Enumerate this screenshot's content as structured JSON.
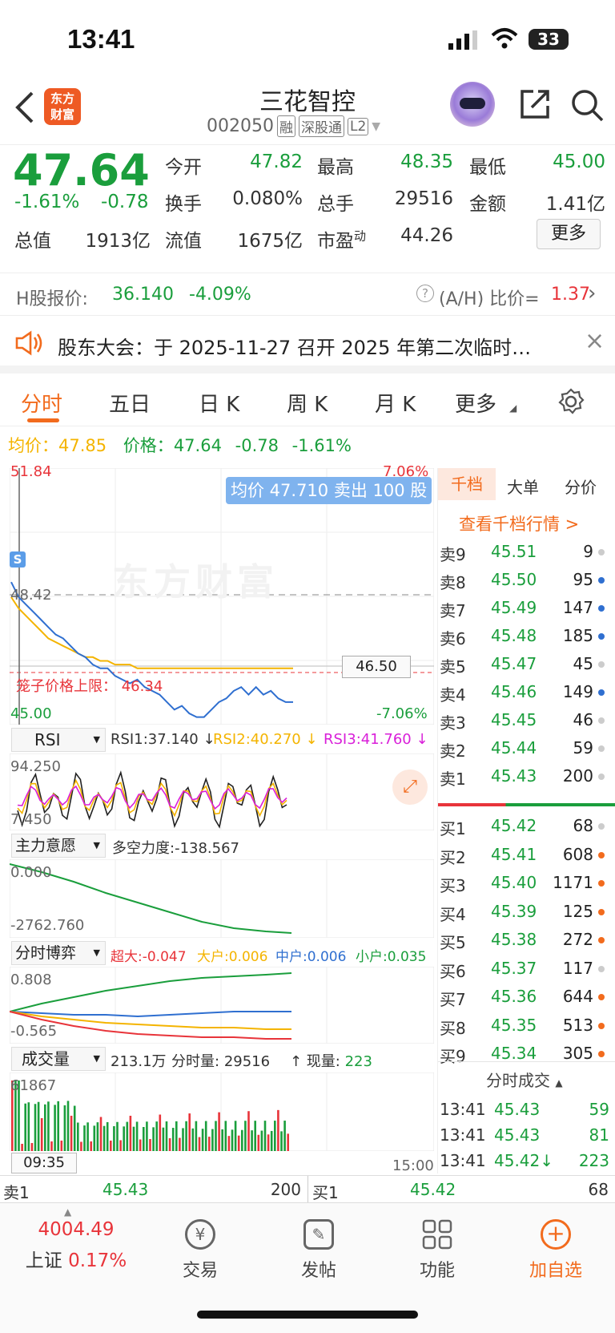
{
  "status": {
    "time": "13:41",
    "battery": "33"
  },
  "header": {
    "title": "三花智控",
    "code": "002050",
    "badges": [
      "融",
      "深股通",
      "L2"
    ],
    "logo_top": "东方",
    "logo_bottom": "财富"
  },
  "quote": {
    "price": "47.64",
    "pct": "-1.61%",
    "chg": "-0.78",
    "fields": [
      {
        "label": "今开",
        "value": "47.82",
        "color": "green"
      },
      {
        "label": "最高",
        "value": "48.35",
        "color": "green"
      },
      {
        "label": "最低",
        "value": "45.00",
        "color": "green"
      },
      {
        "label": "换手",
        "value": "0.080%",
        "color": "dark"
      },
      {
        "label": "总手",
        "value": "29516",
        "color": "dark"
      },
      {
        "label": "金额",
        "value": "1.41亿",
        "color": "dark"
      },
      {
        "label": "流值",
        "value": "1675亿",
        "color": "dark"
      },
      {
        "label": "市盈",
        "value": "44.26",
        "color": "dark"
      }
    ],
    "total_label": "总值",
    "total_value": "1913亿",
    "pe_sup": "动",
    "more": "更多"
  },
  "hshare": {
    "label": "H股报价:",
    "price": "36.140",
    "pct": "-4.09%",
    "ah_label": "(A/H) 比价=",
    "ah_value": "1.37"
  },
  "notice": {
    "text": "股东大会：于 2025-11-27 召开 2025 年第二次临时…"
  },
  "tabs": [
    "分时",
    "五日",
    "日 K",
    "周 K",
    "月 K",
    "更多"
  ],
  "price_line": {
    "avg_label": "均价：",
    "avg": "47.85",
    "price_label": "价格：",
    "price": "47.64",
    "chg": "-0.78",
    "pct": "-1.61%"
  },
  "chart": {
    "top_left": "51.84",
    "top_right": "7.06%",
    "mid_left": "48.42",
    "bot_left": "45.00",
    "bot_right": "-7.06%",
    "tooltip": "均价 47.710 卖出 100 股",
    "ref_price": "46.50",
    "limit_label": "笼子价格上限：",
    "limit_value": "46.34",
    "watermark": "东方财富",
    "s_badge": "S",
    "time_start": "09:35",
    "time_end": "15:00"
  },
  "chart_data": {
    "type": "line",
    "series": [
      {
        "name": "价格",
        "values": [
          48.8,
          48.4,
          48.2,
          48.0,
          47.8,
          47.6,
          47.4,
          47.3,
          47.1,
          46.9,
          46.8,
          46.6,
          46.5,
          46.5,
          46.3,
          46.2,
          46.1,
          46.2,
          46.0,
          45.9,
          45.8,
          45.6,
          45.4,
          45.5,
          45.3,
          45.2,
          45.2,
          45.4,
          45.6,
          45.7,
          45.9,
          46.0,
          45.8,
          46.0,
          45.8,
          45.9,
          45.7,
          45.6,
          45.6
        ]
      },
      {
        "name": "均价",
        "values": [
          48.4,
          48.1,
          47.9,
          47.7,
          47.5,
          47.3,
          47.2,
          47.1,
          47.0,
          46.9,
          46.8,
          46.8,
          46.7,
          46.7,
          46.6,
          46.6,
          46.6,
          46.5,
          46.5,
          46.5,
          46.5,
          46.5,
          46.5,
          46.5,
          46.5,
          46.5,
          46.5,
          46.5,
          46.5,
          46.5,
          46.5,
          46.5,
          46.5,
          46.5,
          46.5,
          46.5,
          46.5,
          46.5,
          46.5
        ]
      }
    ],
    "ylim": [
      45.0,
      51.84
    ]
  },
  "rsi": {
    "name": "RSI",
    "rsi1": "RSI1:37.140 ↓",
    "rsi2": "RSI2:40.270 ↓",
    "rsi3": "RSI3:41.760 ↓",
    "top": "94.250",
    "bot": "7.450"
  },
  "zhuli": {
    "name": "主力意愿",
    "label": "多空力度:",
    "value": "-138.567",
    "top": "0.000",
    "bot": "-2762.760"
  },
  "boyi": {
    "name": "分时博弈",
    "super_label": "超大:",
    "super": "-0.047",
    "big_label": "大户:",
    "big": "0.006",
    "mid_label": "中户:",
    "mid": "0.006",
    "small_label": "小户:",
    "small": "0.035",
    "top": "0.808",
    "bot": "-0.565"
  },
  "volume": {
    "name": "成交量",
    "total": "213.1万",
    "period_label": "分时量:",
    "period": "29516",
    "now_label": "↑ 现量:",
    "now": "223",
    "top": "61867"
  },
  "orderbook": {
    "tabs": [
      "千档",
      "大单",
      "分价"
    ],
    "link": "查看千档行情 >",
    "asks": [
      {
        "label": "卖9",
        "price": "45.51",
        "vol": "9"
      },
      {
        "label": "卖8",
        "price": "45.50",
        "vol": "95"
      },
      {
        "label": "卖7",
        "price": "45.49",
        "vol": "147"
      },
      {
        "label": "卖6",
        "price": "45.48",
        "vol": "185"
      },
      {
        "label": "卖5",
        "price": "45.47",
        "vol": "45"
      },
      {
        "label": "卖4",
        "price": "45.46",
        "vol": "149"
      },
      {
        "label": "卖3",
        "price": "45.45",
        "vol": "46"
      },
      {
        "label": "卖2",
        "price": "45.44",
        "vol": "59"
      },
      {
        "label": "卖1",
        "price": "45.43",
        "vol": "200"
      }
    ],
    "bids": [
      {
        "label": "买1",
        "price": "45.42",
        "vol": "68"
      },
      {
        "label": "买2",
        "price": "45.41",
        "vol": "608"
      },
      {
        "label": "买3",
        "price": "45.40",
        "vol": "1171"
      },
      {
        "label": "买4",
        "price": "45.39",
        "vol": "125"
      },
      {
        "label": "买5",
        "price": "45.38",
        "vol": "272"
      },
      {
        "label": "买6",
        "price": "45.37",
        "vol": "117"
      },
      {
        "label": "买7",
        "price": "45.36",
        "vol": "644"
      },
      {
        "label": "买8",
        "price": "45.35",
        "vol": "513"
      },
      {
        "label": "买9",
        "price": "45.34",
        "vol": "305"
      }
    ],
    "trades_title": "分时成交",
    "trades": [
      {
        "time": "13:41",
        "price": "45.43",
        "vol": "59"
      },
      {
        "time": "13:41",
        "price": "45.43",
        "vol": "81"
      },
      {
        "time": "13:41",
        "price": "45.42↓",
        "vol": "223"
      }
    ]
  },
  "bottom_strip": {
    "sell_label": "卖1",
    "sell_price": "45.43",
    "sell_vol": "200",
    "buy_label": "买1",
    "buy_price": "45.42",
    "buy_vol": "68"
  },
  "nav": {
    "index_value": "4004.49",
    "index_name": "上证",
    "index_pct": "0.17%",
    "items": [
      "交易",
      "发帖",
      "功能",
      "加自选"
    ]
  },
  "colors": {
    "green": "#1a9e3c",
    "red": "#e8343a",
    "orange": "#f26b1d",
    "blue": "#2f6fd0",
    "yellow": "#f4b400",
    "accent_blue": "#5b9de8"
  }
}
